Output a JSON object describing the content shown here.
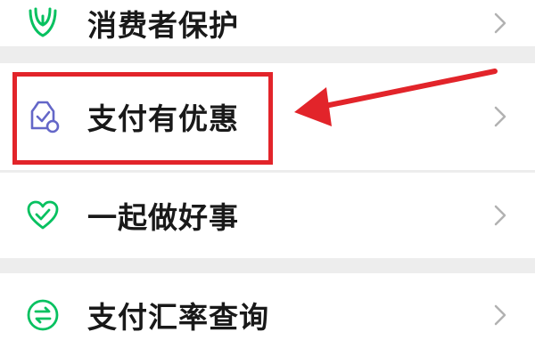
{
  "menu": {
    "items": [
      {
        "label": "消费者保护",
        "icon": "shield-hands-icon"
      },
      {
        "label": "支付有优惠",
        "icon": "coupon-bag-icon"
      },
      {
        "label": "一起做好事",
        "icon": "heart-check-icon"
      },
      {
        "label": "支付汇率查询",
        "icon": "exchange-icon"
      }
    ]
  },
  "annotation": {
    "highlight_color": "#e2242a",
    "arrow_color": "#e2242a",
    "highlighted_item": "支付有优惠"
  },
  "colors": {
    "wechat_green": "#07c160",
    "purple_icon": "#6467c8",
    "text": "#191919",
    "chevron": "#b2b2b2",
    "background": "#ededed"
  }
}
